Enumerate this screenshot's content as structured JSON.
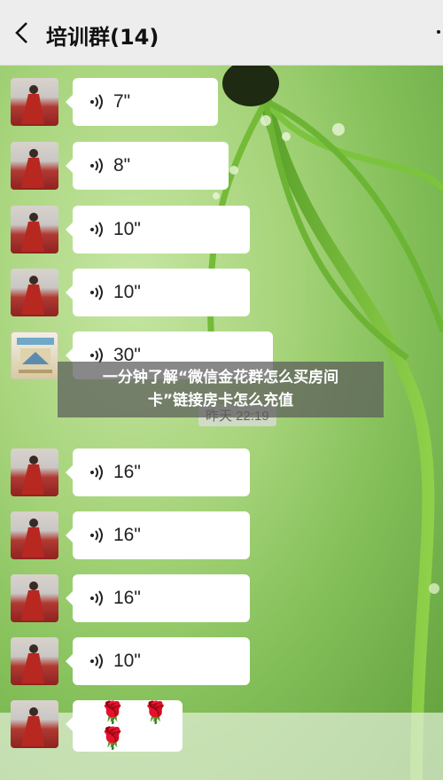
{
  "header": {
    "title": "培训群(14)"
  },
  "messages": [
    {
      "kind": "voice",
      "duration": "7\""
    },
    {
      "kind": "voice",
      "duration": "8\""
    },
    {
      "kind": "voice",
      "duration": "10\""
    },
    {
      "kind": "voice",
      "duration": "10\""
    },
    {
      "kind": "voice",
      "duration": "30\""
    },
    {
      "kind": "voice",
      "duration": "16\""
    },
    {
      "kind": "voice",
      "duration": "16\""
    },
    {
      "kind": "voice",
      "duration": "16\""
    },
    {
      "kind": "voice",
      "duration": "10\""
    },
    {
      "kind": "emoji",
      "text": "🌹 🌹 🌹"
    }
  ],
  "timestamp": "昨天 22:19",
  "overlay": {
    "line1": "一分钟了解“微信金花群怎么买房间",
    "line2": "卡”链接房卡怎么充值"
  },
  "colors": {
    "header_bg": "#ededed",
    "bubble_bg": "#ffffff",
    "background_green": "#86c15b",
    "avatar_red": "#b03a32"
  },
  "icons": {
    "back": "chevron-left-icon",
    "more": "more-icon",
    "voice": "voice-wave-icon"
  }
}
